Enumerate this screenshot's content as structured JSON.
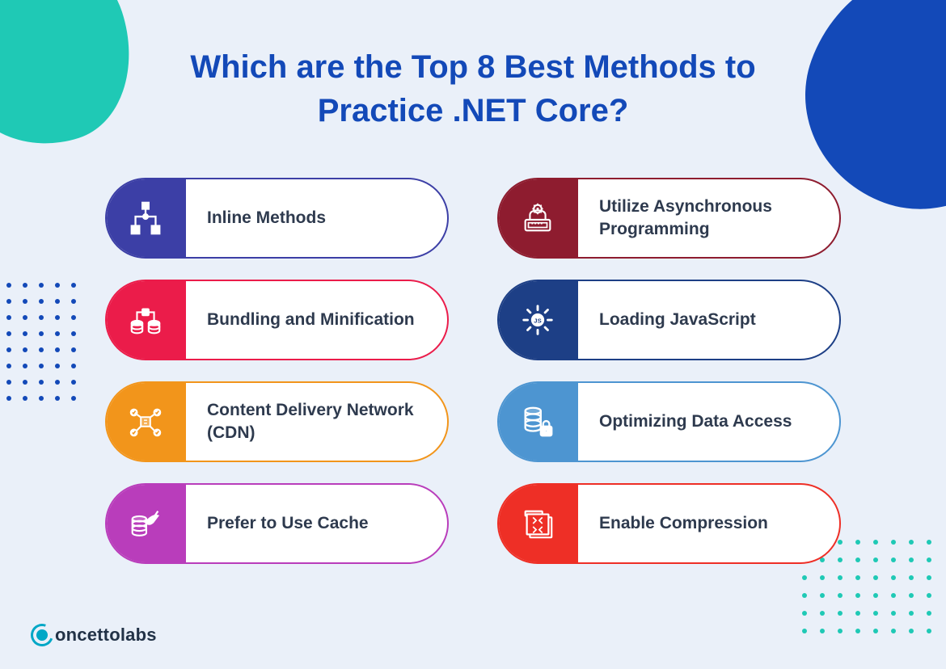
{
  "title": "Which are the Top 8 Best Methods to Practice .NET Core?",
  "footer": {
    "brand": "oncettolabs"
  },
  "colors": {
    "titleColor": "#1349b8",
    "bg": "#eaf0f9",
    "teal": "#1fc9b5"
  },
  "cards": [
    {
      "label": "Inline Methods",
      "color": "#3c3fa6",
      "icon": "nodes-icon"
    },
    {
      "label": "Utilize Asynchronous Programming",
      "color": "#8e1c2f",
      "icon": "typewriter-gear-icon"
    },
    {
      "label": "Bundling and Minification",
      "color": "#eb1c4a",
      "icon": "databases-link-icon"
    },
    {
      "label": "Loading JavaScript",
      "color": "#1d3f86",
      "icon": "js-loading-icon"
    },
    {
      "label": "Content Delivery Network (CDN)",
      "color": "#f2951b",
      "icon": "cdn-network-icon"
    },
    {
      "label": "Optimizing Data Access",
      "color": "#4d95d1",
      "icon": "database-lock-icon"
    },
    {
      "label": "Prefer to Use Cache",
      "color": "#b93dbb",
      "icon": "cache-hand-icon"
    },
    {
      "label": "Enable Compression",
      "color": "#ee2f26",
      "icon": "compress-files-icon"
    }
  ]
}
